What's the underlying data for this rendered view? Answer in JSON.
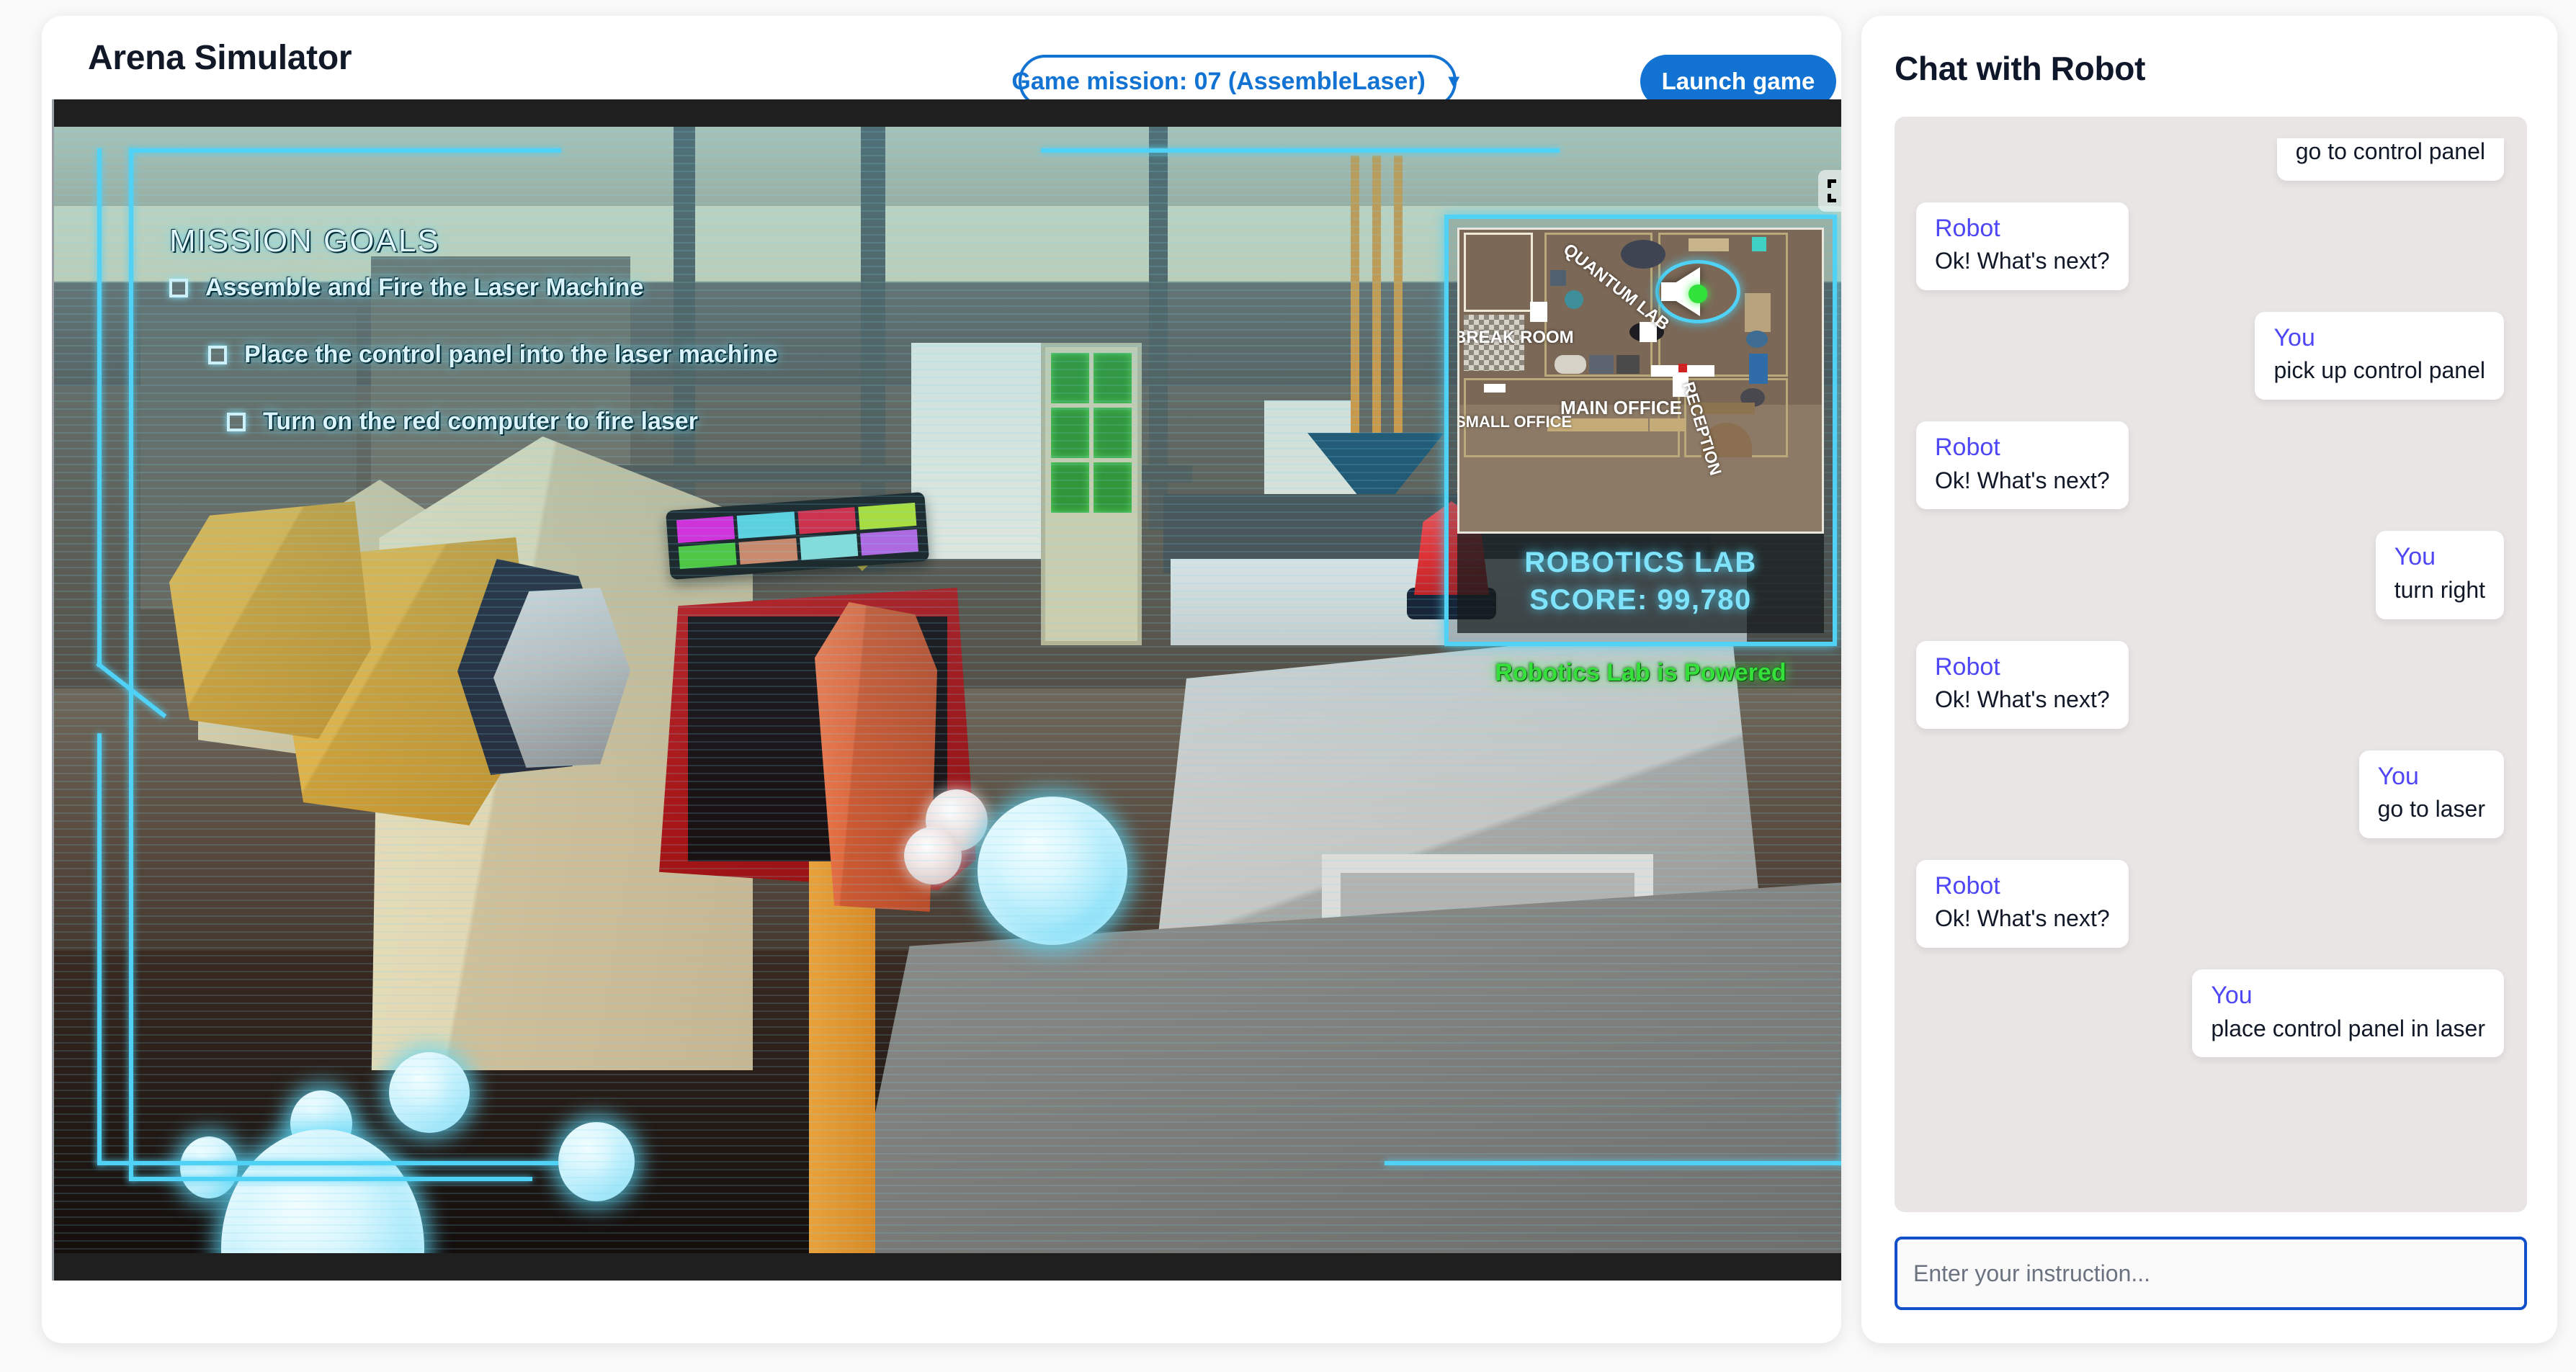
{
  "header": {
    "app_title": "Arena Simulator",
    "mission_select_label": "Game mission: 07 (AssembleLaser)",
    "caret_glyph": "▼",
    "launch_label": "Launch game"
  },
  "game": {
    "hud": {
      "mission_heading": "MISSION GOALS",
      "goals": [
        {
          "text": "Assemble and Fire the Laser Machine",
          "checked": false
        },
        {
          "text": "Place the control panel into the laser machine",
          "checked": false
        },
        {
          "text": "Turn on the red computer to fire laser",
          "checked": false
        }
      ],
      "minimap": {
        "room_labels": [
          "QUANTUM LAB",
          "BREAK ROOM",
          "MAIN OFFICE",
          "RECEPTION",
          "SMALL OFFICE"
        ],
        "title": "ROBOTICS LAB",
        "score_label": "SCORE: 99,780"
      },
      "status_text": "Robotics Lab is Powered",
      "status_color": "#35e03a",
      "accent_color": "#4fd2f5",
      "fullscreen_icon": "fullscreen-expand-icon"
    },
    "control_panel_swatches": [
      "#e222d8",
      "#5fd3dd",
      "#e01f3a",
      "#b5e12a",
      "#4fc832",
      "#d9845f",
      "#8be0d8",
      "#bb5fe0"
    ]
  },
  "chat": {
    "title": "Chat with Robot",
    "messages": [
      {
        "side": "right",
        "sender": "",
        "text": "go to control panel",
        "clipped": true
      },
      {
        "side": "left",
        "sender": "Robot",
        "text": "Ok! What's next?",
        "clipped": false
      },
      {
        "side": "right",
        "sender": "You",
        "text": "pick up control panel",
        "clipped": false
      },
      {
        "side": "left",
        "sender": "Robot",
        "text": "Ok! What's next?",
        "clipped": false
      },
      {
        "side": "right",
        "sender": "You",
        "text": "turn right",
        "clipped": false
      },
      {
        "side": "left",
        "sender": "Robot",
        "text": "Ok! What's next?",
        "clipped": false
      },
      {
        "side": "right",
        "sender": "You",
        "text": "go to laser",
        "clipped": false
      },
      {
        "side": "left",
        "sender": "Robot",
        "text": "Ok! What's next?",
        "clipped": false
      },
      {
        "side": "right",
        "sender": "You",
        "text": "place control panel in laser",
        "clipped": false
      }
    ],
    "input_placeholder": "Enter your instruction...",
    "input_value": "",
    "sender_color": "#4f46f5",
    "focus_border_color": "#1150c8"
  }
}
